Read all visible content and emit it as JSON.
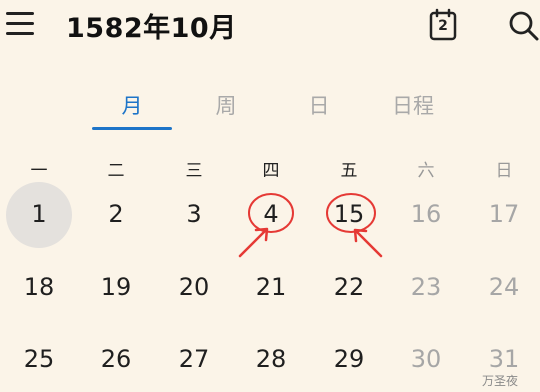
{
  "header": {
    "title": "1582年10月",
    "today_icon_day": "2",
    "icons": [
      "menu-icon",
      "calendar-today-icon",
      "search-icon"
    ]
  },
  "tabs": [
    {
      "label": "月",
      "active": true
    },
    {
      "label": "周",
      "active": false
    },
    {
      "label": "日",
      "active": false
    },
    {
      "label": "日程",
      "active": false
    }
  ],
  "weekdays": [
    "一",
    "二",
    "三",
    "四",
    "五",
    "六",
    "日"
  ],
  "weeks": [
    [
      "1",
      "2",
      "3",
      "4",
      "15",
      "16",
      "17"
    ],
    [
      "18",
      "19",
      "20",
      "21",
      "22",
      "23",
      "24"
    ],
    [
      "25",
      "26",
      "27",
      "28",
      "29",
      "30",
      "31"
    ]
  ],
  "selected_day": "1",
  "highlighted_days": [
    "4",
    "15"
  ],
  "colors": {
    "accent": "#1d74c8",
    "annotation": "#e53935",
    "background": "#fbf4e8",
    "weekend_text": "#a6a6a6"
  },
  "watermark": "万圣夜"
}
